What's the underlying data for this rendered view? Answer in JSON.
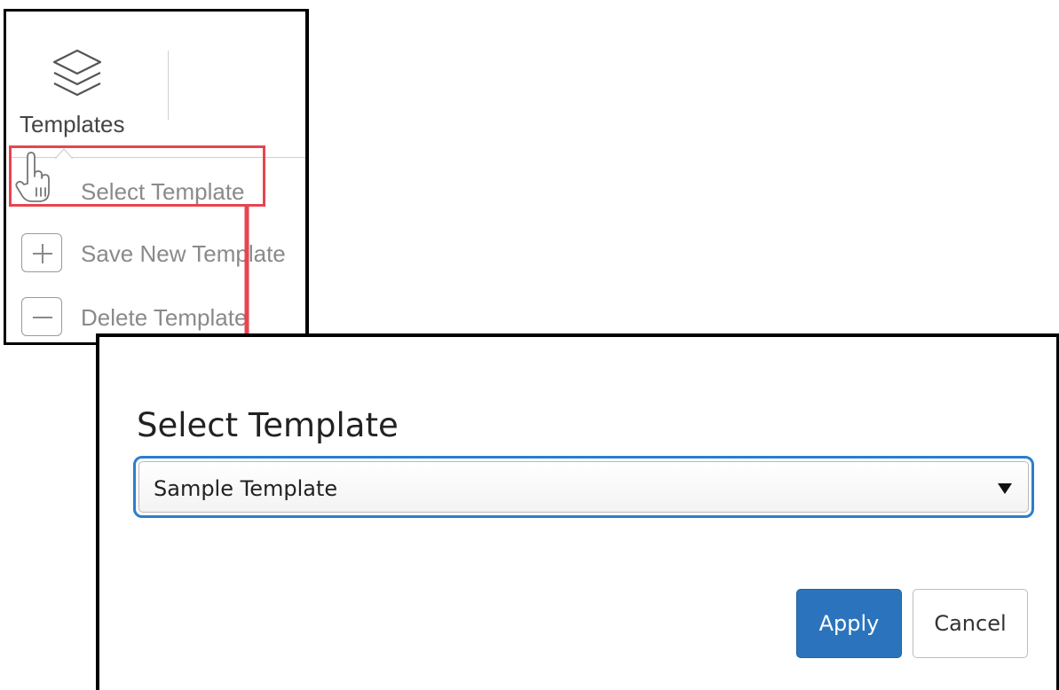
{
  "toolbar": {
    "templates_label": "Templates",
    "templates_icon": "layers-icon"
  },
  "templates_menu": {
    "items": [
      {
        "label": "Select Template",
        "icon": "hand-pointer-icon",
        "highlighted": true
      },
      {
        "label": "Save New Template",
        "icon": "plus-icon"
      },
      {
        "label": "Delete Template",
        "icon": "minus-icon"
      }
    ]
  },
  "dialog": {
    "title": "Select Template",
    "select": {
      "value": "Sample Template"
    },
    "apply_label": "Apply",
    "cancel_label": "Cancel"
  },
  "colors": {
    "highlight": "#e64550",
    "primary": "#2b74bd",
    "focus_border": "#2a7fcc"
  }
}
